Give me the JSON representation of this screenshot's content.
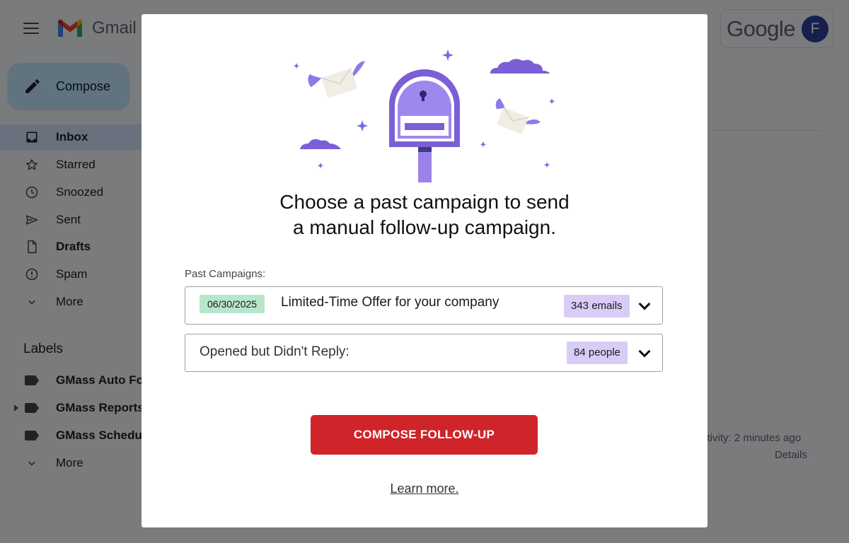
{
  "gmail": {
    "app_name": "Gmail",
    "compose_label": "Compose",
    "nav": [
      {
        "label": "Inbox",
        "icon": "inbox-icon",
        "bold": true,
        "active": true
      },
      {
        "label": "Starred",
        "icon": "star-icon"
      },
      {
        "label": "Snoozed",
        "icon": "clock-icon"
      },
      {
        "label": "Sent",
        "icon": "send-icon"
      },
      {
        "label": "Drafts",
        "icon": "draft-icon",
        "bold": true
      },
      {
        "label": "Spam",
        "icon": "spam-icon"
      },
      {
        "label": "More",
        "icon": "chevron-down-icon"
      }
    ],
    "labels_heading": "Labels",
    "labels": [
      {
        "label": "GMass Auto Fo",
        "icon": "label-tag-icon"
      },
      {
        "label": "GMass Reports",
        "icon": "label-tag-icon"
      },
      {
        "label": "GMass Schedu",
        "icon": "label-tag-icon"
      }
    ],
    "labels_more": "More",
    "google_text": "Google",
    "avatar_letter": "F",
    "activity_text": "ctivity: 2 minutes ago",
    "details_text": "Details"
  },
  "modal": {
    "headline_line1": "Choose a past campaign to send",
    "headline_line2": "a manual follow-up campaign.",
    "past_campaigns_label": "Past Campaigns:",
    "campaign": {
      "date": "06/30/2025",
      "name": "Limited-Time Offer for your company",
      "count": "343 emails"
    },
    "segment": {
      "label": "Opened but Didn't Reply:",
      "count": "84 people"
    },
    "cta_label": "COMPOSE FOLLOW-UP",
    "learn_more": "Learn more."
  },
  "colors": {
    "cta": "#d0242b",
    "mailbox_purple": "#7b5fd6",
    "date_badge": "#b8e6cc",
    "count_badge": "#d9ccf7"
  }
}
